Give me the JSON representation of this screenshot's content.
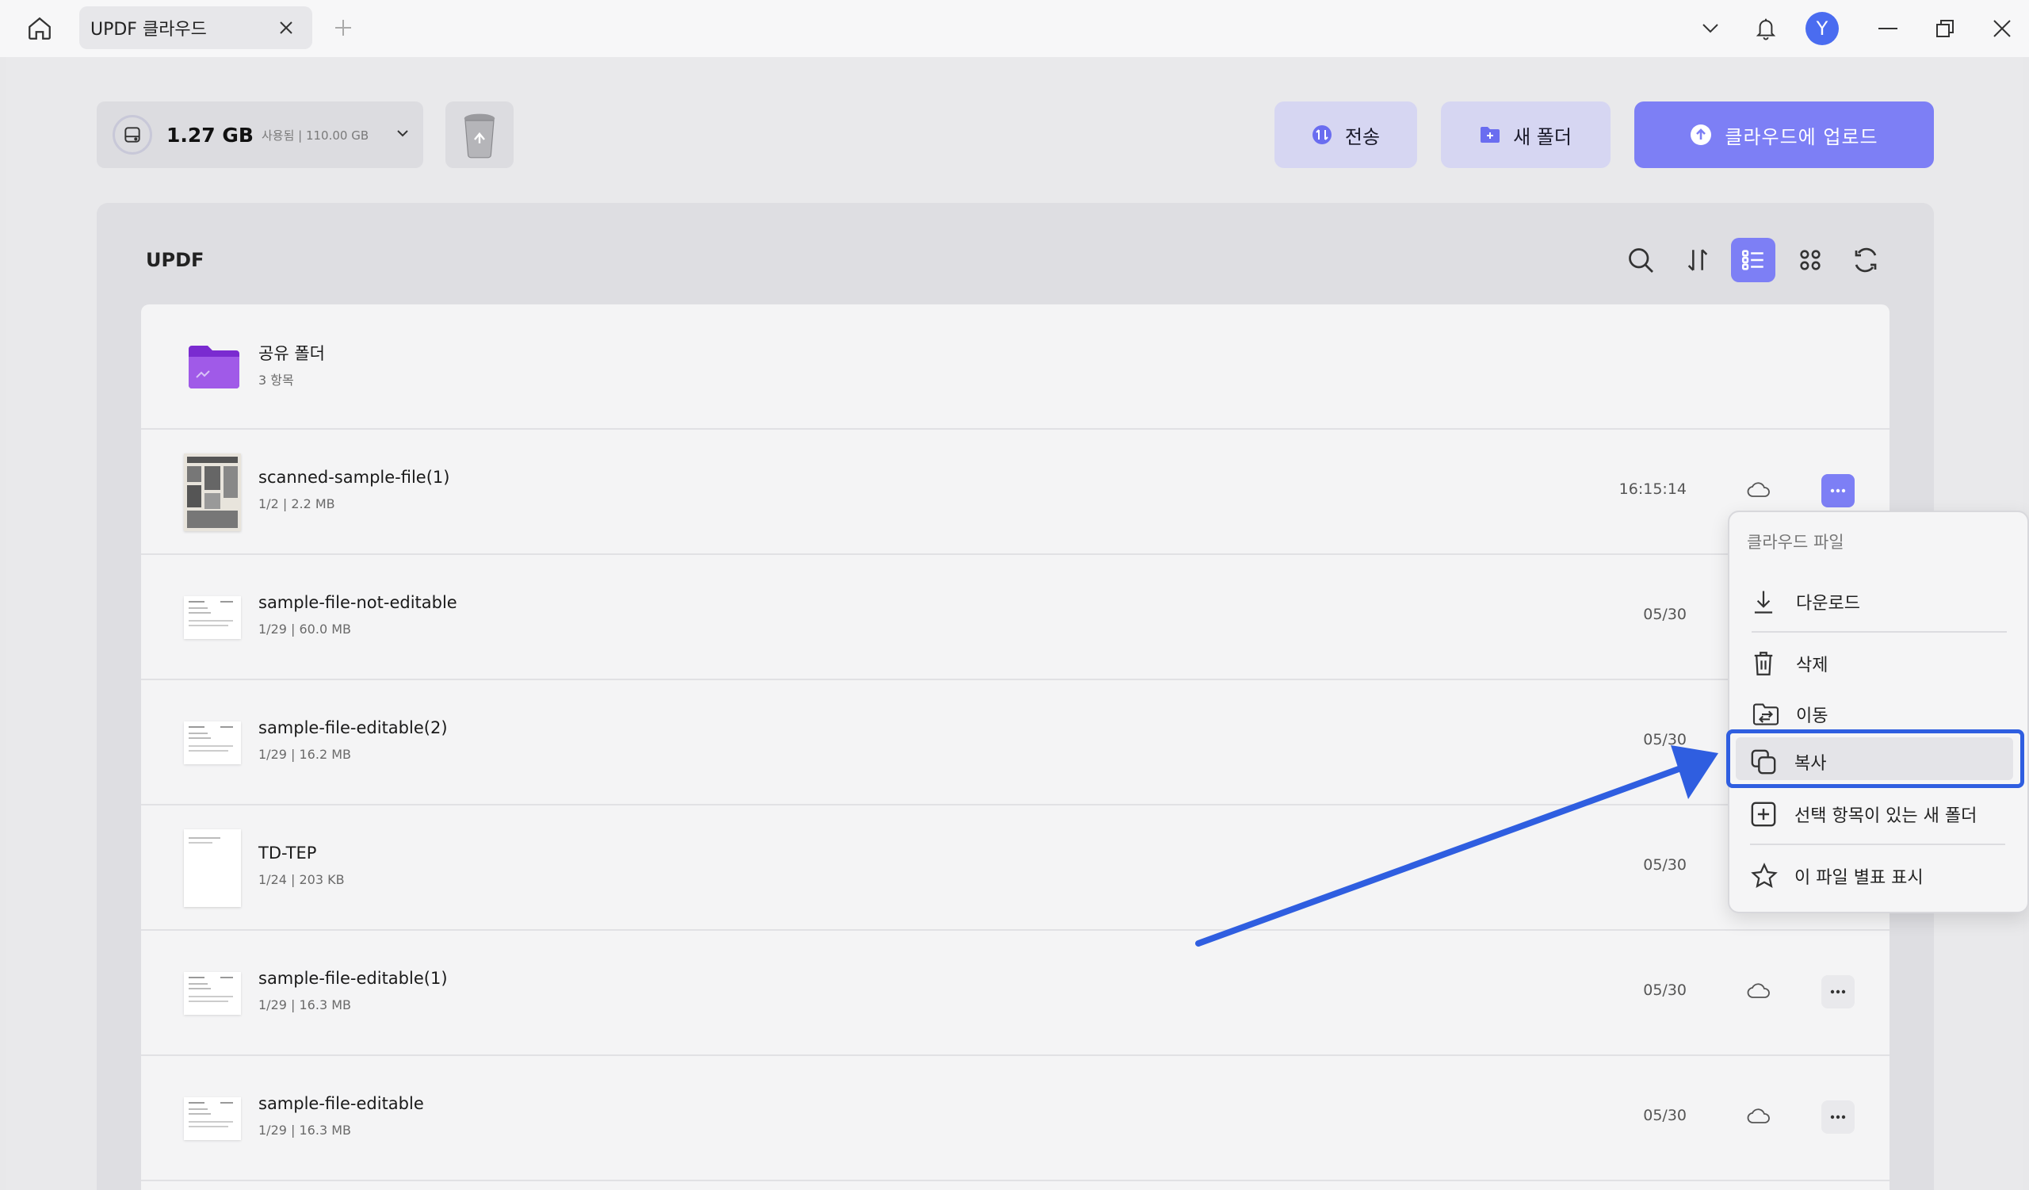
{
  "titlebar": {
    "tab_title": "UPDF 클라우드",
    "avatar_letter": "Y"
  },
  "toolbar": {
    "storage_used": "1.27 GB",
    "storage_detail": "사용됨 | 110.00 GB",
    "transfer_label": "전송",
    "new_folder_label": "새 폴더",
    "upload_label": "클라우드에 업로드"
  },
  "panel": {
    "title": "UPDF"
  },
  "folder": {
    "name": "공유 폴더",
    "meta": "3 항목"
  },
  "files": [
    {
      "name": "scanned-sample-file(1)",
      "meta": "1/2 | 2.2 MB",
      "date": "16:15:14"
    },
    {
      "name": "sample-file-not-editable",
      "meta": "1/29 | 60.0 MB",
      "date": "05/30"
    },
    {
      "name": "sample-file-editable(2)",
      "meta": "1/29 | 16.2 MB",
      "date": "05/30"
    },
    {
      "name": "TD-TEP",
      "meta": "1/24 | 203 KB",
      "date": "05/30"
    },
    {
      "name": "sample-file-editable(1)",
      "meta": "1/29 | 16.3 MB",
      "date": "05/30"
    },
    {
      "name": "sample-file-editable",
      "meta": "1/29 | 16.3 MB",
      "date": "05/30"
    }
  ],
  "context_menu": {
    "header": "클라우드 파일",
    "download": "다운로드",
    "delete": "삭제",
    "move": "이동",
    "copy": "복사",
    "new_folder_with_selection": "선택 항목이 있는 새 폴더",
    "star": "이 파일 별표 표시"
  },
  "colors": {
    "accent": "#7d7ff5",
    "highlight": "#2f5ee0",
    "folder": "#8b3bd9"
  }
}
